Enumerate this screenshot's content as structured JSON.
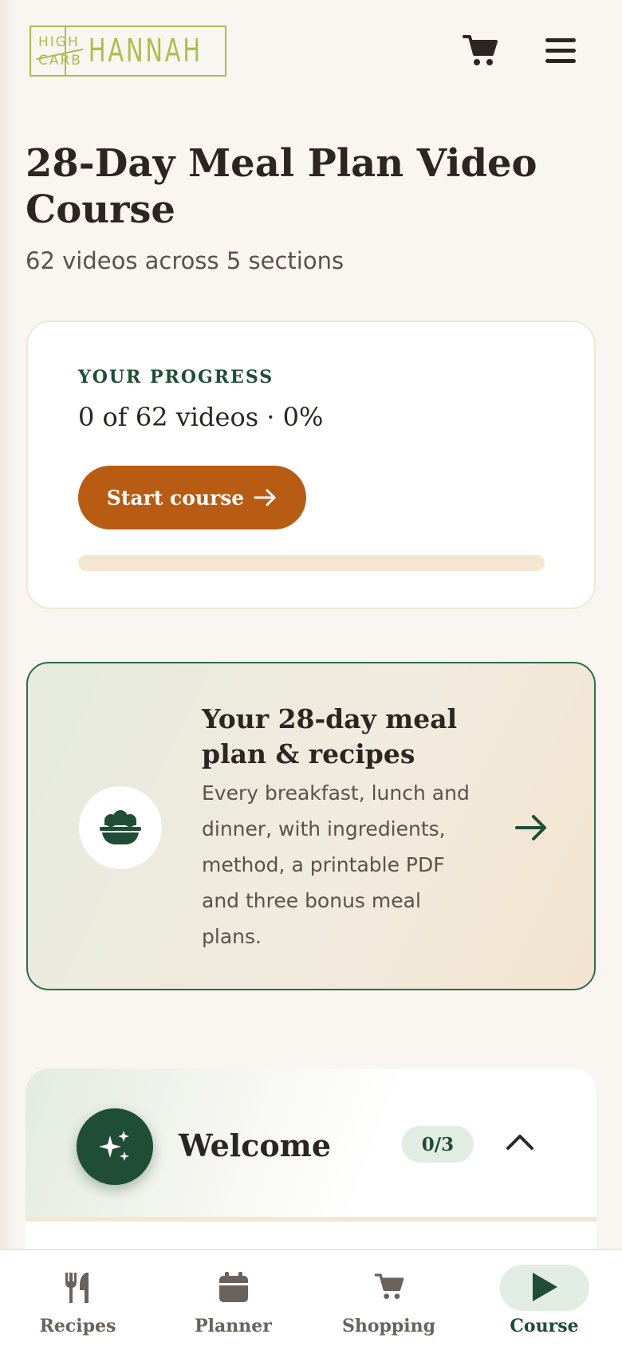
{
  "brand": {
    "logo_small_line1": "HIGH",
    "logo_small_line2": "CARB",
    "logo_big": "HANNAH",
    "color": "#a9c04b"
  },
  "header": {
    "cart_icon": "cart-icon",
    "menu_icon": "hamburger-menu-icon"
  },
  "course": {
    "title": "28-Day Meal Plan Video Course",
    "subtitle": "62 videos across 5 sections"
  },
  "progress": {
    "label": "YOUR PROGRESS",
    "summary": "0 of 62 videos · 0%",
    "completed": 0,
    "total": 62,
    "percent": 0,
    "start_button": "Start course",
    "accent": "#b85c14"
  },
  "meal_plan": {
    "title": "Your 28-day meal plan & recipes",
    "description": "Every breakfast, lunch and dinner, with ingredients, method, a printable PDF and three bonus meal plans.",
    "icon": "bowl-icon"
  },
  "sections": [
    {
      "title": "Welcome",
      "badge": "0/3",
      "icon": "sparkles-icon",
      "expanded": true
    }
  ],
  "bottom_nav": {
    "items": [
      {
        "label": "Recipes",
        "icon": "fork-knife-icon",
        "active": false
      },
      {
        "label": "Planner",
        "icon": "calendar-icon",
        "active": false
      },
      {
        "label": "Shopping",
        "icon": "cart-icon",
        "active": false
      },
      {
        "label": "Course",
        "icon": "play-icon",
        "active": true
      }
    ]
  },
  "colors": {
    "background": "#f9f5f0",
    "primary_green": "#1f4d36",
    "accent_orange": "#b85c14",
    "text_dark": "#2b2622"
  }
}
